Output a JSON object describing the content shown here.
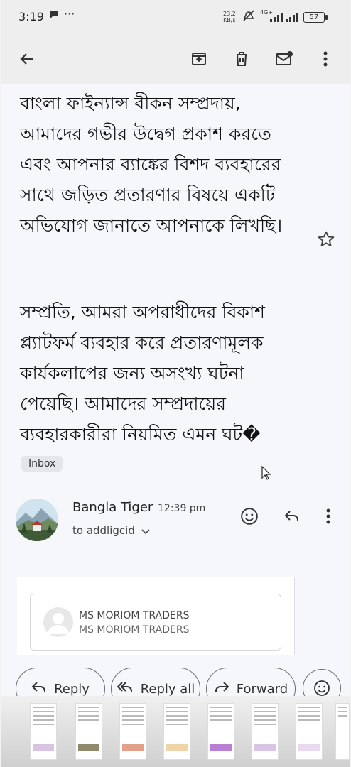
{
  "status_bar": {
    "time": "3:19",
    "net_speed": "23.2",
    "net_unit": "KB/s",
    "network_type": "4G+",
    "battery": "57"
  },
  "toolbar": {
    "icons": [
      "back-arrow-icon",
      "archive-icon",
      "delete-icon",
      "mark-unread-icon",
      "more-vert-icon"
    ]
  },
  "message": {
    "paragraph1": "বাংলা ফাইন্যান্স বীকন সম্প্রদায়, আমাদের গভীর উদ্বেগ প্রকাশ করতে এবং আপনার ব্যাঙ্কের বিশদ ব্যবহারের সাথে জড়িত প্রতারণার বিষয়ে একটি অভিযোগ জানাতে আপনাকে লিখছি।",
    "paragraph2": "সম্প্রতি, আমরা অপরাধীদের বিকাশ প্ল্যাটফর্ম ব্যবহার করে প্রতারণামূলক কার্যকলাপের জন্য অসংখ্য ঘটনা পেয়েছি। আমাদের সম্প্রদায়ের ব্যবহারকারীরা নিয়মিত এমন ঘট�",
    "label": "Inbox"
  },
  "sender": {
    "name": "Bangla Tiger",
    "time": "12:39 pm",
    "to": "to addligcid"
  },
  "preview_card": {
    "title": "MS MORIOM TRADERS",
    "subtitle": "MS MORIOM TRADERS"
  },
  "actions": {
    "reply": "Reply",
    "reply_all": "Reply all",
    "forward": "Forward"
  },
  "colors": {
    "background": "#f5f7fb",
    "toolbar": "#eeeeee",
    "text": "#111111",
    "chip": "#e4e6ea"
  }
}
